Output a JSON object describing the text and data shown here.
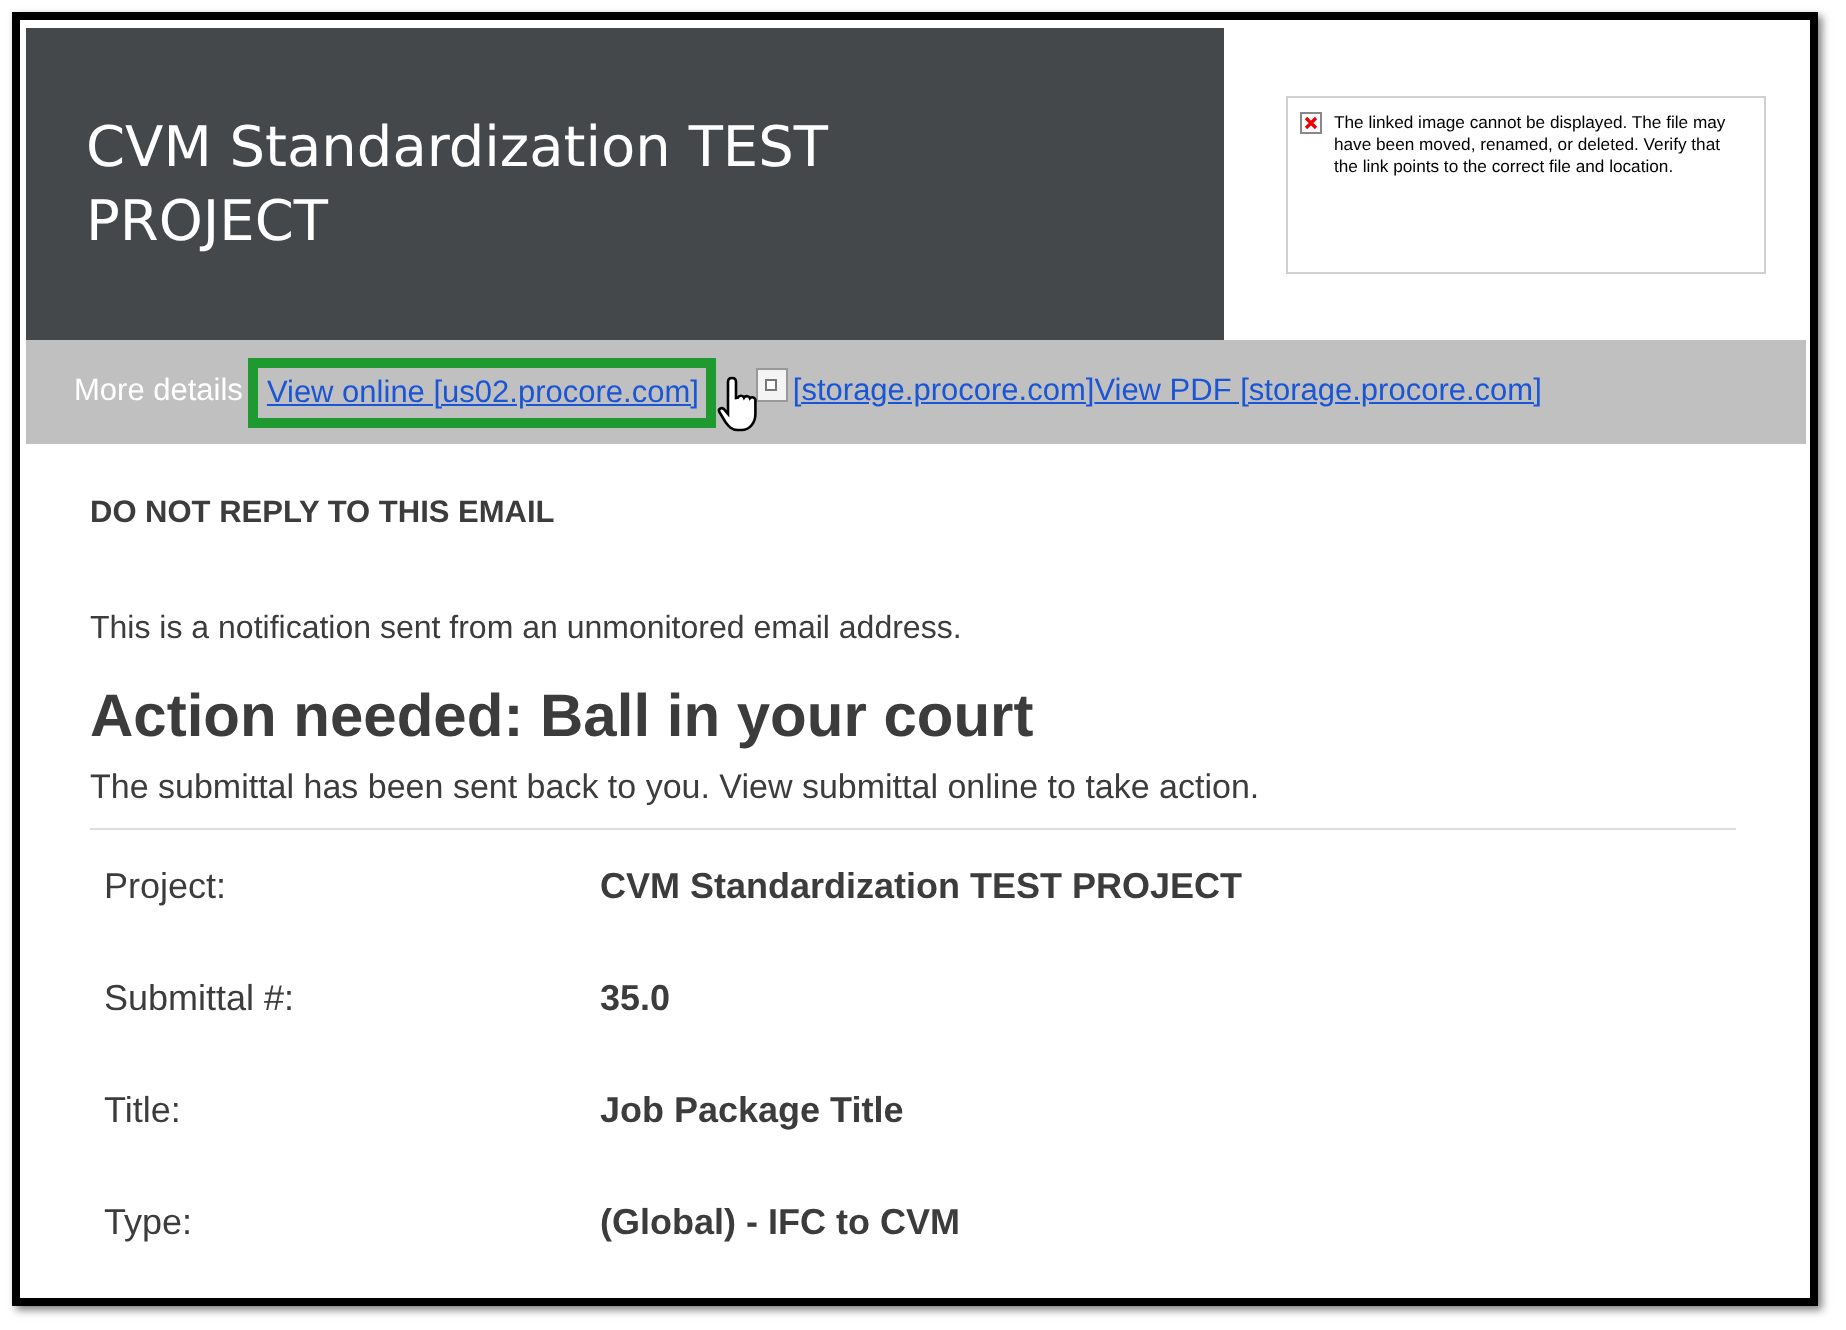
{
  "header": {
    "title": "CVM Standardization TEST PROJECT",
    "broken_image_message": "The linked image cannot be displayed.  The file may have been moved, renamed, or deleted. Verify that the link points to the correct file and location."
  },
  "details_bar": {
    "label": "More details",
    "links": [
      {
        "text": "View online [us02.procore.com]",
        "highlighted": true
      },
      {
        "text": "[storage.procore.com]",
        "highlighted": false
      },
      {
        "text": "View PDF [storage.procore.com]",
        "highlighted": false
      }
    ]
  },
  "notice_heading": "DO NOT REPLY TO THIS EMAIL",
  "notice_text": "This is a notification sent from an unmonitored email address.",
  "action_heading": "Action needed: Ball in your court",
  "action_text": "The submittal has been sent back to you. View submittal online to take action.",
  "fields": [
    {
      "label": "Project:",
      "value": "CVM Standardization TEST PROJECT"
    },
    {
      "label": "Submittal #:",
      "value": "35.0"
    },
    {
      "label": "Title:",
      "value": "Job Package Title"
    },
    {
      "label": "Type:",
      "value": "(Global) - IFC to CVM"
    }
  ]
}
